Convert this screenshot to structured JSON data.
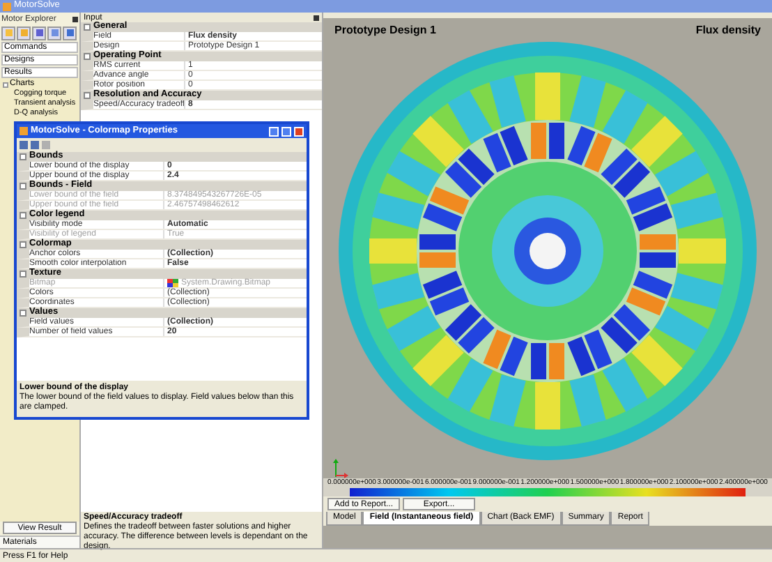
{
  "app": {
    "title": "MotorSolve",
    "status_bar": "Press F1 for Help"
  },
  "explorer": {
    "title": "Motor Explorer",
    "sections": [
      {
        "label": "Commands"
      },
      {
        "label": "Designs"
      },
      {
        "label": "Results"
      }
    ],
    "tree": [
      {
        "label": "Charts",
        "expanded": true,
        "children": [
          {
            "label": "Cogging torque"
          },
          {
            "label": "Transient analysis"
          },
          {
            "label": "D-Q analysis"
          }
        ]
      }
    ],
    "view_button": "View Result",
    "bottom_tab": "Materials"
  },
  "input": {
    "title": "Input",
    "rows": [
      {
        "kind": "category",
        "label": "General"
      },
      {
        "kind": "property",
        "label": "Field",
        "value": "Flux density",
        "modified": true,
        "disabled": false
      },
      {
        "kind": "property",
        "label": "Design",
        "value": "Prototype Design 1",
        "modified": false,
        "disabled": false
      },
      {
        "kind": "category",
        "label": "Operating Point"
      },
      {
        "kind": "property",
        "label": "RMS current",
        "value": "1",
        "modified": false,
        "disabled": false
      },
      {
        "kind": "property",
        "label": "Advance angle",
        "value": "0",
        "modified": false,
        "disabled": false
      },
      {
        "kind": "property",
        "label": "Rotor position",
        "value": "0",
        "modified": false,
        "disabled": false
      },
      {
        "kind": "category",
        "label": "Resolution and Accuracy"
      },
      {
        "kind": "property",
        "label": "Speed/Accuracy tradeoff",
        "value": "8",
        "modified": true,
        "disabled": false
      }
    ],
    "help_title": "Speed/Accuracy tradeoff",
    "help_text": "Defines the tradeoff between faster solutions and higher accuracy. The difference between levels is dependant on the design."
  },
  "dialog": {
    "title": "MotorSolve - Colormap Properties",
    "rows": [
      {
        "kind": "category",
        "label": "Bounds"
      },
      {
        "kind": "property",
        "label": "Lower bound of the display",
        "value": "0",
        "modified": true,
        "disabled": false
      },
      {
        "kind": "property",
        "label": "Upper bound of the display",
        "value": "2.4",
        "modified": true,
        "disabled": false
      },
      {
        "kind": "category",
        "label": "Bounds - Field"
      },
      {
        "kind": "property",
        "label": "Lower bound of the field",
        "value": "8.374849543267726E-05",
        "modified": false,
        "disabled": true
      },
      {
        "kind": "property",
        "label": "Upper bound of the field",
        "value": "2.46757498462612",
        "modified": false,
        "disabled": true
      },
      {
        "kind": "category",
        "label": "Color legend"
      },
      {
        "kind": "property",
        "label": "Visibility mode",
        "value": "Automatic",
        "modified": true,
        "disabled": false
      },
      {
        "kind": "property",
        "label": "Visibility of legend",
        "value": "True",
        "modified": false,
        "disabled": true
      },
      {
        "kind": "category",
        "label": "Colormap"
      },
      {
        "kind": "property",
        "label": "Anchor colors",
        "value": "(Collection)",
        "modified": true,
        "disabled": false
      },
      {
        "kind": "property",
        "label": "Smooth color interpolation",
        "value": "False",
        "modified": true,
        "disabled": false
      },
      {
        "kind": "category",
        "label": "Texture"
      },
      {
        "kind": "bitmap",
        "label": "Bitmap",
        "value": "System.Drawing.Bitmap",
        "modified": false,
        "disabled": true
      },
      {
        "kind": "property",
        "label": "Colors",
        "value": "(Collection)",
        "modified": false,
        "disabled": false
      },
      {
        "kind": "property",
        "label": "Coordinates",
        "value": "(Collection)",
        "modified": false,
        "disabled": false
      },
      {
        "kind": "category",
        "label": "Values"
      },
      {
        "kind": "property",
        "label": "Field values",
        "value": "(Collection)",
        "modified": true,
        "disabled": false
      },
      {
        "kind": "property",
        "label": "Number of field values",
        "value": "20",
        "modified": true,
        "disabled": false
      }
    ],
    "help_title": "Lower bound of the display",
    "help_text": "The lower bound of the field values to display. Field values below than this are clamped."
  },
  "view": {
    "design": "Prototype Design 1",
    "field": "Flux density",
    "scale_labels": [
      "0.000000e+000",
      "3.000000e-001",
      "6.000000e-001",
      "9.000000e-001",
      "1.200000e+000",
      "1.500000e+000",
      "1.800000e+000",
      "2.100000e+000",
      "2.400000e+000"
    ],
    "buttons": [
      "Add to Report...",
      "Export..."
    ],
    "tabs": [
      {
        "label": "Model",
        "selected": false
      },
      {
        "label": "Field (Instantaneous field)",
        "selected": true
      },
      {
        "label": "Chart (Back EMF)",
        "selected": false
      },
      {
        "label": "Summary",
        "selected": false
      },
      {
        "label": "Report",
        "selected": false
      }
    ]
  }
}
